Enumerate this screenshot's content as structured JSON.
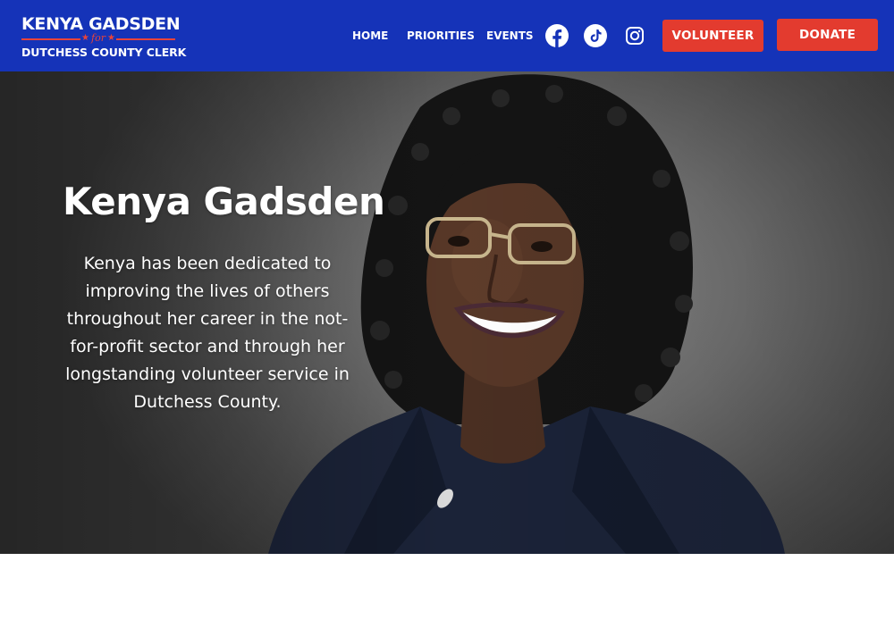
{
  "header": {
    "logo": {
      "name": "KENYA GADSDEN",
      "for": "for",
      "subtitle": "DUTCHESS COUNTY CLERK"
    },
    "nav": [
      {
        "label": "HOME"
      },
      {
        "label": "PRIORITIES"
      },
      {
        "label": "EVENTS"
      }
    ],
    "social": [
      {
        "icon": "facebook-icon"
      },
      {
        "icon": "tiktok-icon"
      },
      {
        "icon": "instagram-icon"
      }
    ],
    "buttons": {
      "volunteer": "VOLUNTEER",
      "donate": "DONATE"
    }
  },
  "hero": {
    "title": "Kenya Gadsden",
    "text": "Kenya has been dedicated to improving the lives of others throughout her career in the not-for-profit sector and through her longstanding volunteer service in Dutchess County."
  },
  "colors": {
    "header_bg": "#1533b8",
    "button_bg": "#e33b2f",
    "accent_red": "#e8433a",
    "text_white": "#ffffff"
  }
}
